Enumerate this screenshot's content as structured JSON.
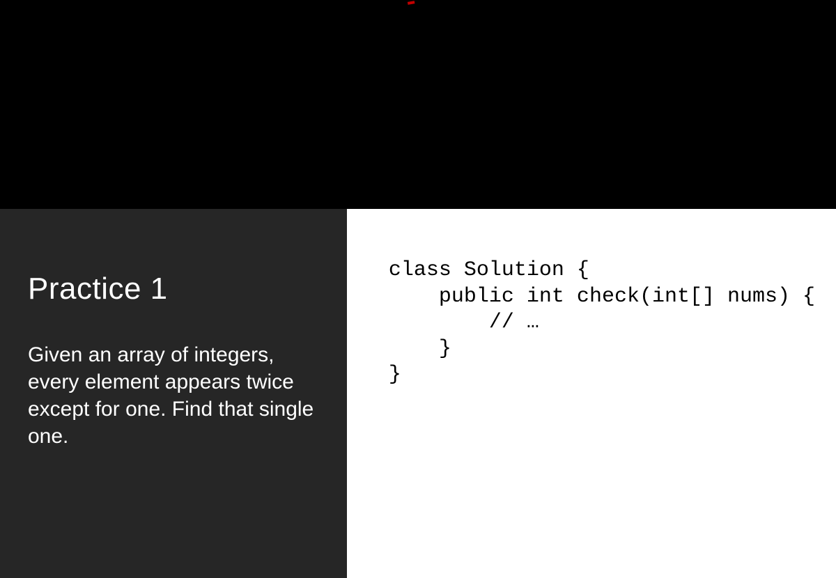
{
  "left": {
    "title": "Practice 1",
    "description": "Given an array of integers, every element appears twice except for one. Find that single one."
  },
  "code": {
    "line1": "class Solution {",
    "line2": "    public int check(int[] nums) {",
    "line3": "        // …",
    "line4": "    }",
    "line5": "}"
  }
}
